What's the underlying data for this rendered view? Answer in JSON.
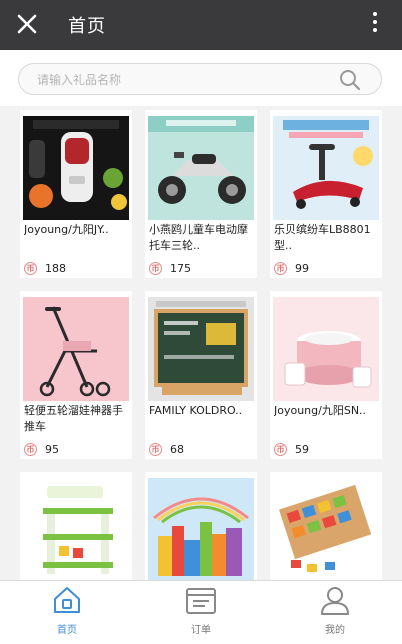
{
  "header": {
    "title": "首页",
    "close_icon": "close-icon",
    "more_icon": "more-vertical-icon"
  },
  "search": {
    "placeholder": "请输入礼品名称",
    "icon": "search-icon"
  },
  "products": [
    {
      "name": "Joyoung/九阳JY..",
      "points": "188",
      "image": "juicer-bottle"
    },
    {
      "name": "小燕鸥儿童车电动摩托车三轮..",
      "points": "175",
      "image": "kids-motorcycle"
    },
    {
      "name": "乐贝缤纷车LB8801型..",
      "points": "99",
      "image": "swing-car"
    },
    {
      "name": "轻便五轮溜娃神器手推车",
      "points": "95",
      "image": "stroller"
    },
    {
      "name": "FAMILY KOLDRO..",
      "points": "68",
      "image": "chalkboard"
    },
    {
      "name": "Joyoung/九阳SN..",
      "points": "59",
      "image": "yogurt-maker"
    },
    {
      "name": "",
      "points": "",
      "image": "building-blocks-toy"
    },
    {
      "name": "",
      "points": "",
      "image": "block-castle"
    },
    {
      "name": "",
      "points": "",
      "image": "wooden-shape-puzzle"
    }
  ],
  "coin_symbol": "币",
  "tabs": [
    {
      "label": "首页",
      "icon": "home-icon",
      "active": true
    },
    {
      "label": "订单",
      "icon": "orders-icon",
      "active": false
    },
    {
      "label": "我的",
      "icon": "profile-icon",
      "active": false
    }
  ],
  "colors": {
    "header_bg": "#3a3a3c",
    "accent": "#3e8fd6",
    "coin": "#e06f6f"
  }
}
